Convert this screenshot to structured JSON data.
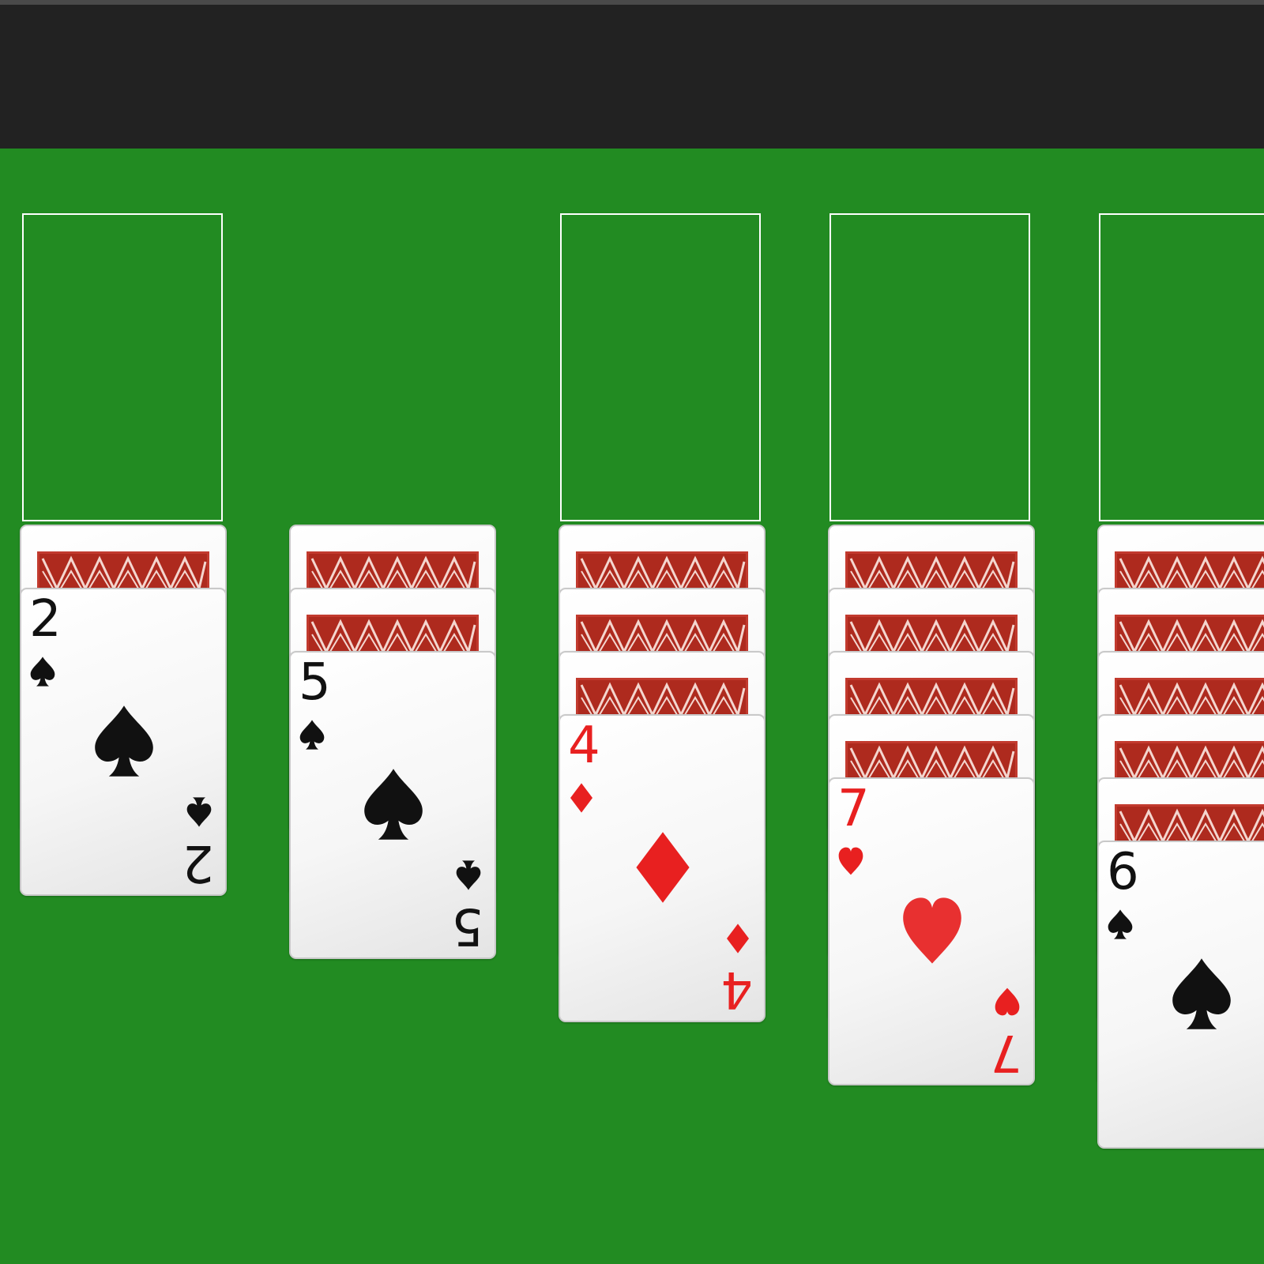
{
  "colors": {
    "top_bar": "#222222",
    "felt": "#228b22",
    "slot_outline": "#ffffff",
    "card_back": "#ae2a1e",
    "red_suit": "#e82020",
    "black_suit": "#111111"
  },
  "foundations": {
    "slots": [
      {
        "empty": true
      },
      {
        "empty": true
      },
      {
        "empty": true
      },
      {
        "empty": true
      },
      {
        "empty": true
      }
    ]
  },
  "tableau": {
    "piles": [
      {
        "face_down": 1,
        "top": {
          "rank": "2",
          "suit": "spade-icon",
          "color": "black"
        }
      },
      {
        "face_down": 2,
        "top": {
          "rank": "5",
          "suit": "spade-icon",
          "color": "black"
        }
      },
      {
        "face_down": 3,
        "top": {
          "rank": "4",
          "suit": "diamond-icon",
          "color": "red"
        }
      },
      {
        "face_down": 4,
        "top": {
          "rank": "7",
          "suit": "heart-icon",
          "color": "red"
        }
      },
      {
        "face_down": 5,
        "top": {
          "rank": "6",
          "suit": "spade-icon",
          "color": "black"
        }
      }
    ]
  }
}
